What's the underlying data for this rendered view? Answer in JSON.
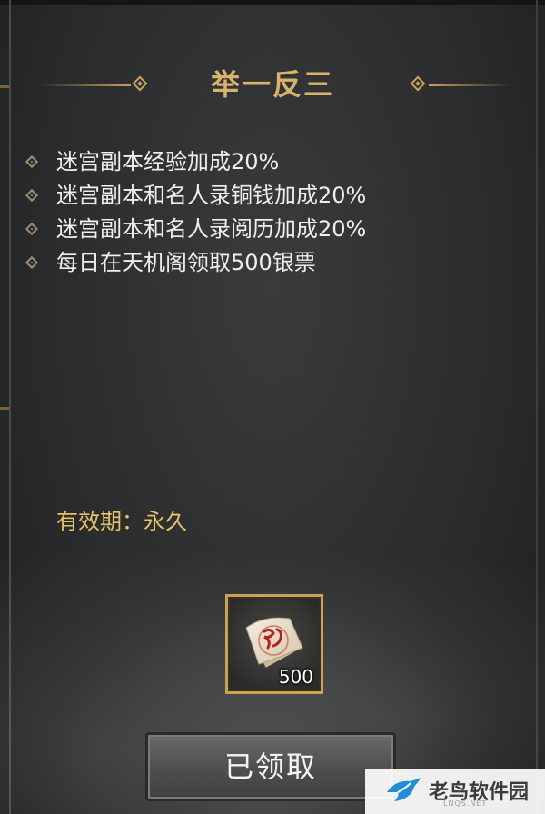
{
  "title": "举一反三",
  "benefits": [
    "迷宫副本经验加成20%",
    "迷宫副本和名人录铜钱加成20%",
    "迷宫副本和名人录阅历加成20%",
    "每日在天机阁领取500银票"
  ],
  "validity": {
    "label": "有效期：",
    "value": "永久"
  },
  "item": {
    "icon": "silver-note-icon",
    "count": "500"
  },
  "button": {
    "label": "已领取"
  },
  "watermark": {
    "name": "老鸟软件园",
    "sub": "LNQS.NET"
  },
  "colors": {
    "title": "#d9b36a",
    "validity": "#e6c46a",
    "text": "#f0efec",
    "slot_border": "#c9a256"
  }
}
